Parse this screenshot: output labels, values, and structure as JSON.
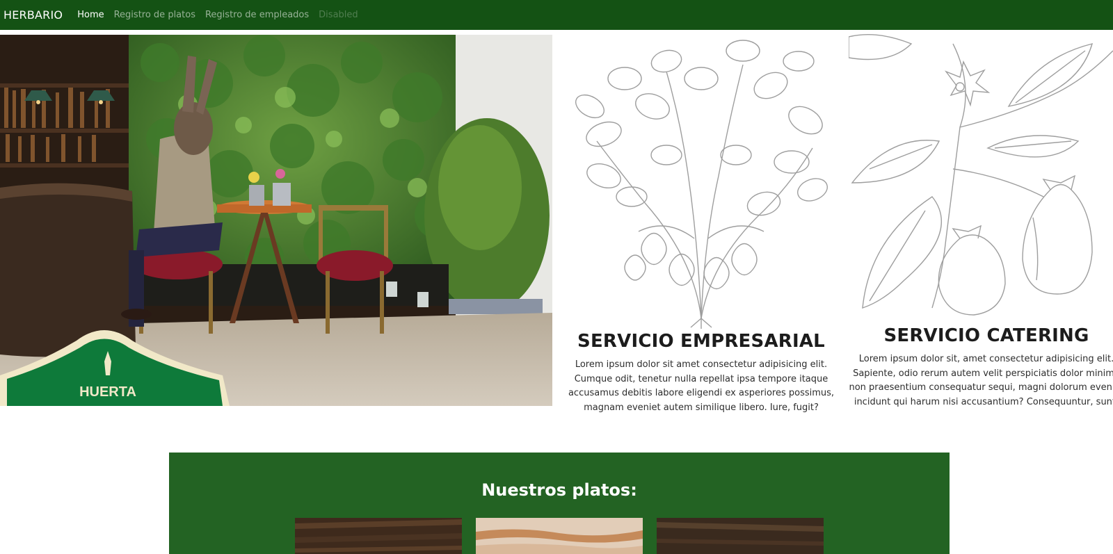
{
  "navbar": {
    "brand": "HERBARIO",
    "links": [
      {
        "label": "Home",
        "state": "active"
      },
      {
        "label": "Registro de platos",
        "state": "normal"
      },
      {
        "label": "Registro de empleados",
        "state": "normal"
      },
      {
        "label": "Disabled",
        "state": "disabled"
      }
    ]
  },
  "hero": {
    "sign_text": "HUERTA"
  },
  "services": [
    {
      "title": "SERVICIO EMPRESARIAL",
      "text": "Lorem ipsum dolor sit amet consectetur adipisicing elit. Cumque odit, tenetur nulla repellat ipsa tempore itaque accusamus debitis labore eligendi ex asperiores possimus, magnam eveniet autem similique libero. Iure, fugit?"
    },
    {
      "title": "SERVICIO CATERING",
      "text": "Lorem ipsum dolor sit, amet consectetur adipisicing elit. Sapiente, odio rerum autem velit perspiciatis dolor minima non praesentium consequatur sequi, magni dolorum eveniet incidunt qui harum nisi accusantium? Consequuntur, sunt."
    }
  ],
  "platos": {
    "title": "Nuestros platos:"
  },
  "colors": {
    "navbar": "#145214",
    "section": "#236323",
    "sketch": "#9e9e9e"
  }
}
